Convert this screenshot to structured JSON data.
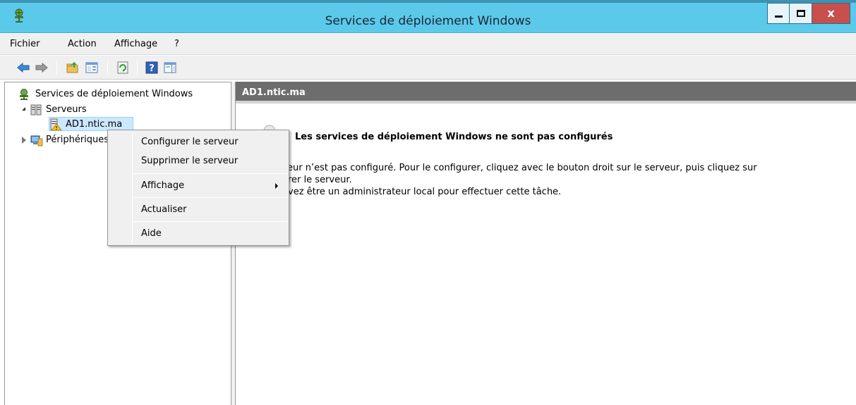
{
  "window": {
    "title": "Services de déploiement Windows",
    "close_glyph": "x"
  },
  "menubar": {
    "items": [
      "Fichier",
      "Action",
      "Affichage",
      "?"
    ]
  },
  "toolbar": {
    "icons": [
      "back-arrow-icon",
      "forward-arrow-icon",
      "up-folder-icon",
      "show-hide-tree-icon",
      "refresh-icon",
      "help-icon",
      "action-pane-icon"
    ]
  },
  "tree": {
    "root": "Services de déploiement Windows",
    "servers": "Serveurs",
    "server_node": "AD1.ntic.ma",
    "devices": "Périphériques"
  },
  "details": {
    "header": "AD1.ntic.ma",
    "heading": "Les services de déploiement Windows ne sont pas configurés",
    "line1": "eur n’est pas configuré. Pour le configurer, cliquez avec le bouton droit sur le serveur, puis cliquez sur",
    "line2": "rer le serveur.",
    "line3": "vez être un administrateur local pour effectuer cette tâche."
  },
  "context_menu": {
    "configure": "Configurer le serveur",
    "remove": "Supprimer le serveur",
    "view": "Affichage",
    "refresh": "Actualiser",
    "help": "Aide"
  },
  "colors": {
    "title_bar": "#5bc9ea",
    "close_button": "#c7504c",
    "header_band": "#6d6d6d",
    "selection": "#cce8ff"
  }
}
